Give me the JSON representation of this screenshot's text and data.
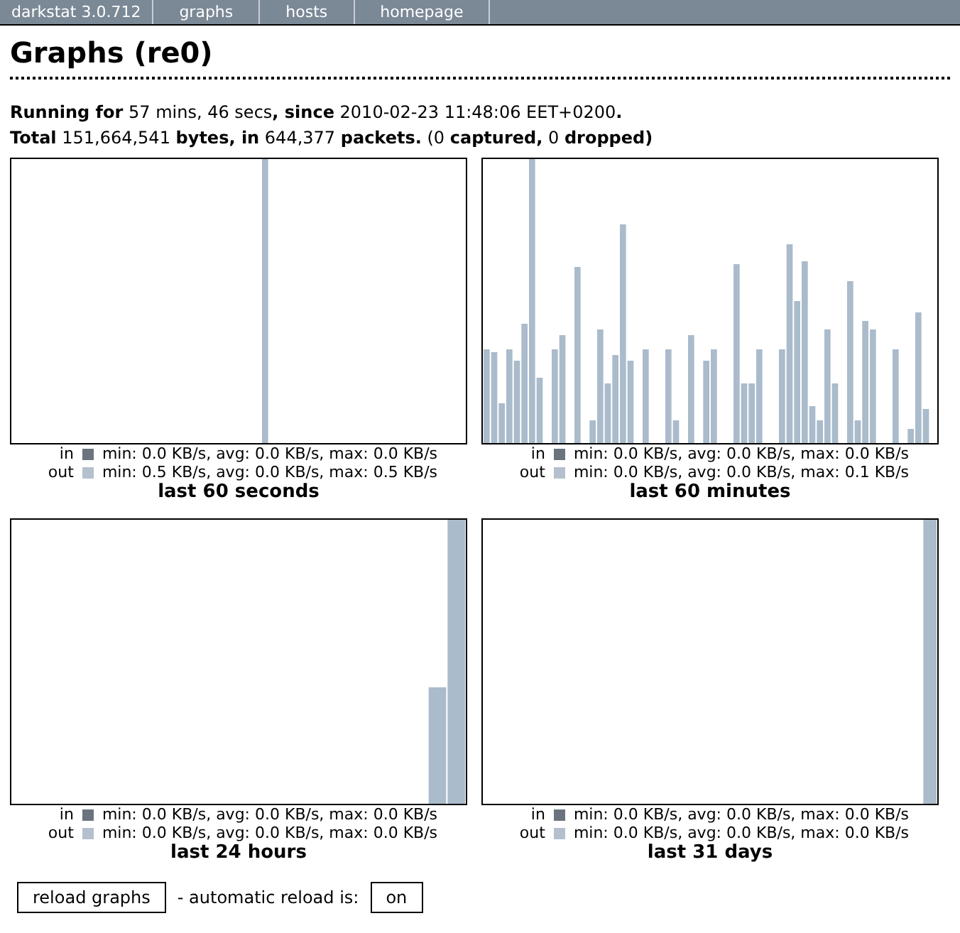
{
  "navbar": {
    "items": [
      "darkstat 3.0.712",
      "graphs",
      "hosts",
      "homepage"
    ]
  },
  "title": "Graphs (re0)",
  "summary": [
    "**Running for** 57 mins, 46 secs**, since** 2010-02-23 11:48:06 EET+0200**.**",
    "**Total** 151,664,541 **bytes, in** 644,377 **packets.** (0 **captured,** 0 **dropped)**"
  ],
  "graphs": [
    {
      "caption": "last 60 seconds",
      "legend": [
        {
          "label": "in",
          "text": "min: 0.0 KB/s, avg: 0.0 KB/s, max: 0.0 KB/s"
        },
        {
          "label": "out",
          "text": "min: 0.5 KB/s, avg: 0.0 KB/s, max: 0.5 KB/s"
        }
      ]
    },
    {
      "caption": "last 60 minutes",
      "legend": [
        {
          "label": "in",
          "text": "min: 0.0 KB/s, avg: 0.0 KB/s, max: 0.0 KB/s"
        },
        {
          "label": "out",
          "text": "min: 0.0 KB/s, avg: 0.0 KB/s, max: 0.1 KB/s"
        }
      ]
    },
    {
      "caption": "last 24 hours",
      "legend": [
        {
          "label": "in",
          "text": "min: 0.0 KB/s, avg: 0.0 KB/s, max: 0.0 KB/s"
        },
        {
          "label": "out",
          "text": "min: 0.0 KB/s, avg: 0.0 KB/s, max: 0.0 KB/s"
        }
      ]
    },
    {
      "caption": "last 31 days",
      "legend": [
        {
          "label": "in",
          "text": "min: 0.0 KB/s, avg: 0.0 KB/s, max: 0.0 KB/s"
        },
        {
          "label": "out",
          "text": "min: 0.0 KB/s, avg: 0.0 KB/s, max: 0.0 KB/s"
        }
      ]
    }
  ],
  "reload_button": "reload graphs",
  "auto_reload_label": "- automatic reload is:",
  "auto_reload_button": "on"
}
